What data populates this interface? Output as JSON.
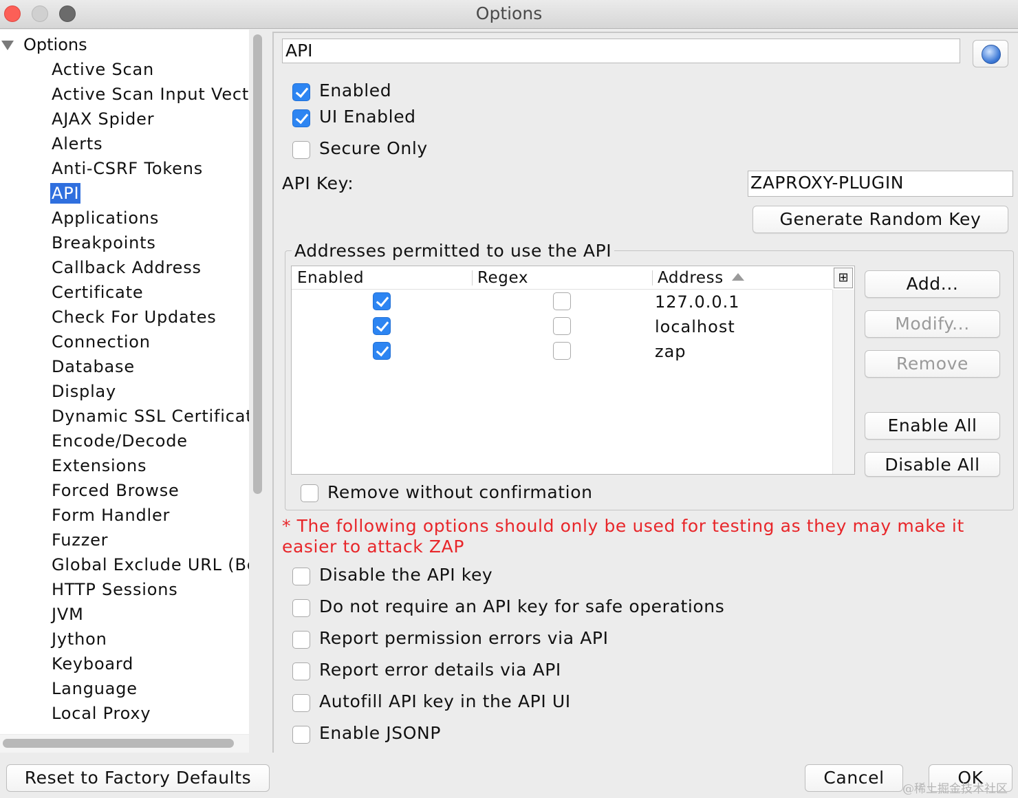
{
  "window": {
    "title": "Options"
  },
  "tree": {
    "root": "Options",
    "items": [
      "Active Scan",
      "Active Scan Input Vectors",
      "AJAX Spider",
      "Alerts",
      "Anti-CSRF Tokens",
      "API",
      "Applications",
      "Breakpoints",
      "Callback Address",
      "Certificate",
      "Check For Updates",
      "Connection",
      "Database",
      "Display",
      "Dynamic SSL Certificates",
      "Encode/Decode",
      "Extensions",
      "Forced Browse",
      "Form Handler",
      "Fuzzer",
      "Global Exclude URL (Beta",
      "HTTP Sessions",
      "JVM",
      "Jython",
      "Keyboard",
      "Language",
      "Local Proxy"
    ],
    "selected": "API"
  },
  "panel": {
    "title": "API",
    "enabled": {
      "label": "Enabled",
      "checked": true
    },
    "ui_enabled": {
      "label": "UI Enabled",
      "checked": true
    },
    "secure_only": {
      "label": "Secure Only",
      "checked": false
    },
    "api_key_label": "API Key:",
    "api_key_value": "ZAPROXY-PLUGIN",
    "generate_key_label": "Generate Random Key",
    "addresses": {
      "group_title": "Addresses permitted to use the API",
      "columns": [
        "Enabled",
        "Regex",
        "Address"
      ],
      "rows": [
        {
          "enabled": true,
          "regex": false,
          "address": "127.0.0.1"
        },
        {
          "enabled": true,
          "regex": false,
          "address": "localhost"
        },
        {
          "enabled": true,
          "regex": false,
          "address": "zap"
        }
      ],
      "buttons": {
        "add": "Add...",
        "modify": "Modify...",
        "remove": "Remove",
        "enable_all": "Enable All",
        "disable_all": "Disable All"
      },
      "remove_without_confirmation": "Remove without confirmation"
    },
    "warning": "* The following options should only be used for testing as they may make it easier to attack ZAP",
    "testing_options": [
      "Disable the API key",
      "Do not require an API key for safe operations",
      "Report permission errors via API",
      "Report error details via API",
      "Autofill API key in the API UI",
      "Enable JSONP"
    ]
  },
  "footer": {
    "reset": "Reset to Factory Defaults",
    "cancel": "Cancel",
    "ok": "OK"
  },
  "watermark": "@稀土掘金技术社区",
  "colors": {
    "selection": "#2f6fde",
    "checkbox_on": "#2d85f2",
    "warning": "#e8262a"
  }
}
